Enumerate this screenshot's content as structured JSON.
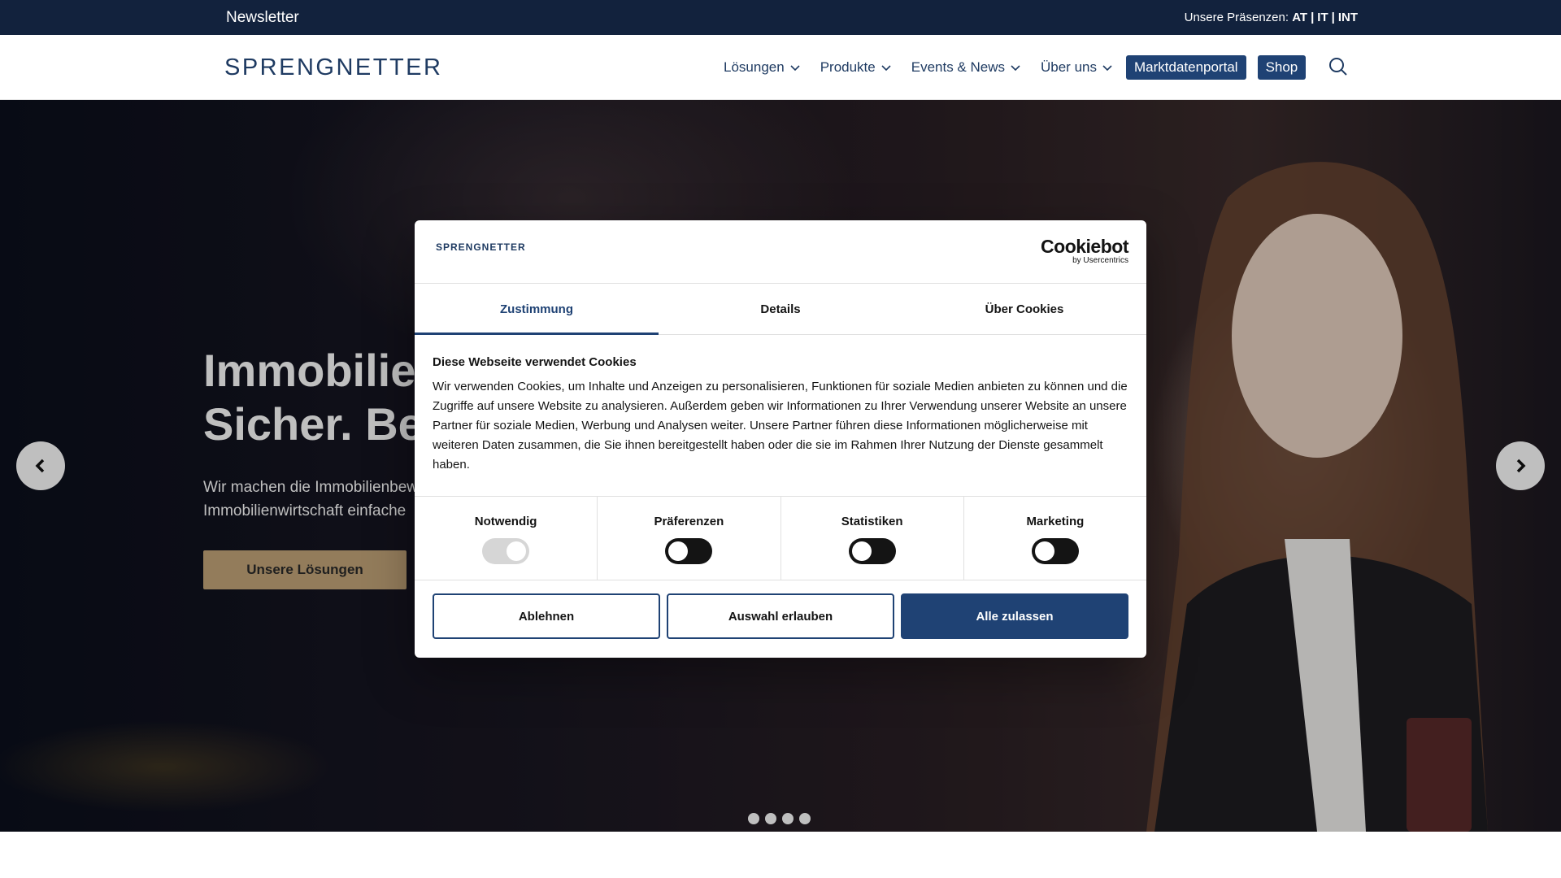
{
  "topbar": {
    "newsletter": "Newsletter",
    "presence_label": "Unsere Präsenzen:",
    "presence_links": [
      "AT",
      "IT",
      "INT"
    ],
    "presence_separator": "|"
  },
  "header": {
    "logo_text": "SPRENGNETTER",
    "nav": [
      {
        "label": "Lösungen"
      },
      {
        "label": "Produkte"
      },
      {
        "label": "Events & News"
      },
      {
        "label": "Über uns"
      }
    ],
    "buttons": {
      "marktdaten": "Marktdatenportal",
      "shop": "Shop"
    },
    "search_icon": "search-icon"
  },
  "hero": {
    "title": "Immobilie\nSicher. Be",
    "text": "Wir machen die Immobilienbew\nImmobilienwirtschaft einfache",
    "cta": "Unsere Lösungen",
    "slides": 4
  },
  "cookie": {
    "logo_text": "SPRENGNETTER",
    "brand_name": "Cookiebot",
    "brand_sub": "by Usercentrics",
    "tabs": [
      {
        "label": "Zustimmung",
        "active": true
      },
      {
        "label": "Details",
        "active": false
      },
      {
        "label": "Über Cookies",
        "active": false
      }
    ],
    "heading": "Diese Webseite verwendet Cookies",
    "body": "Wir verwenden Cookies, um Inhalte und Anzeigen zu personalisieren, Funktionen für soziale Medien anbieten zu können und die Zugriffe auf unsere Website zu analysieren. Außerdem geben wir Informationen zu Ihrer Verwendung unserer Website an unsere Partner für soziale Medien, Werbung und Analysen weiter. Unsere Partner führen diese Informationen möglicherweise mit weiteren Daten zusammen, die Sie ihnen bereitgestellt haben oder die sie im Rahmen Ihrer Nutzung der Dienste gesammelt haben.",
    "categories": [
      {
        "label": "Notwendig",
        "on": true,
        "disabled": true
      },
      {
        "label": "Präferenzen",
        "on": false,
        "disabled": false
      },
      {
        "label": "Statistiken",
        "on": false,
        "disabled": false
      },
      {
        "label": "Marketing",
        "on": false,
        "disabled": false
      }
    ],
    "buttons": {
      "decline": "Ablehnen",
      "allow_selection": "Auswahl erlauben",
      "allow_all": "Alle zulassen"
    }
  },
  "colors": {
    "navy": "#12223d",
    "brand_blue": "#1f4274",
    "gold": "#c4a67a"
  }
}
